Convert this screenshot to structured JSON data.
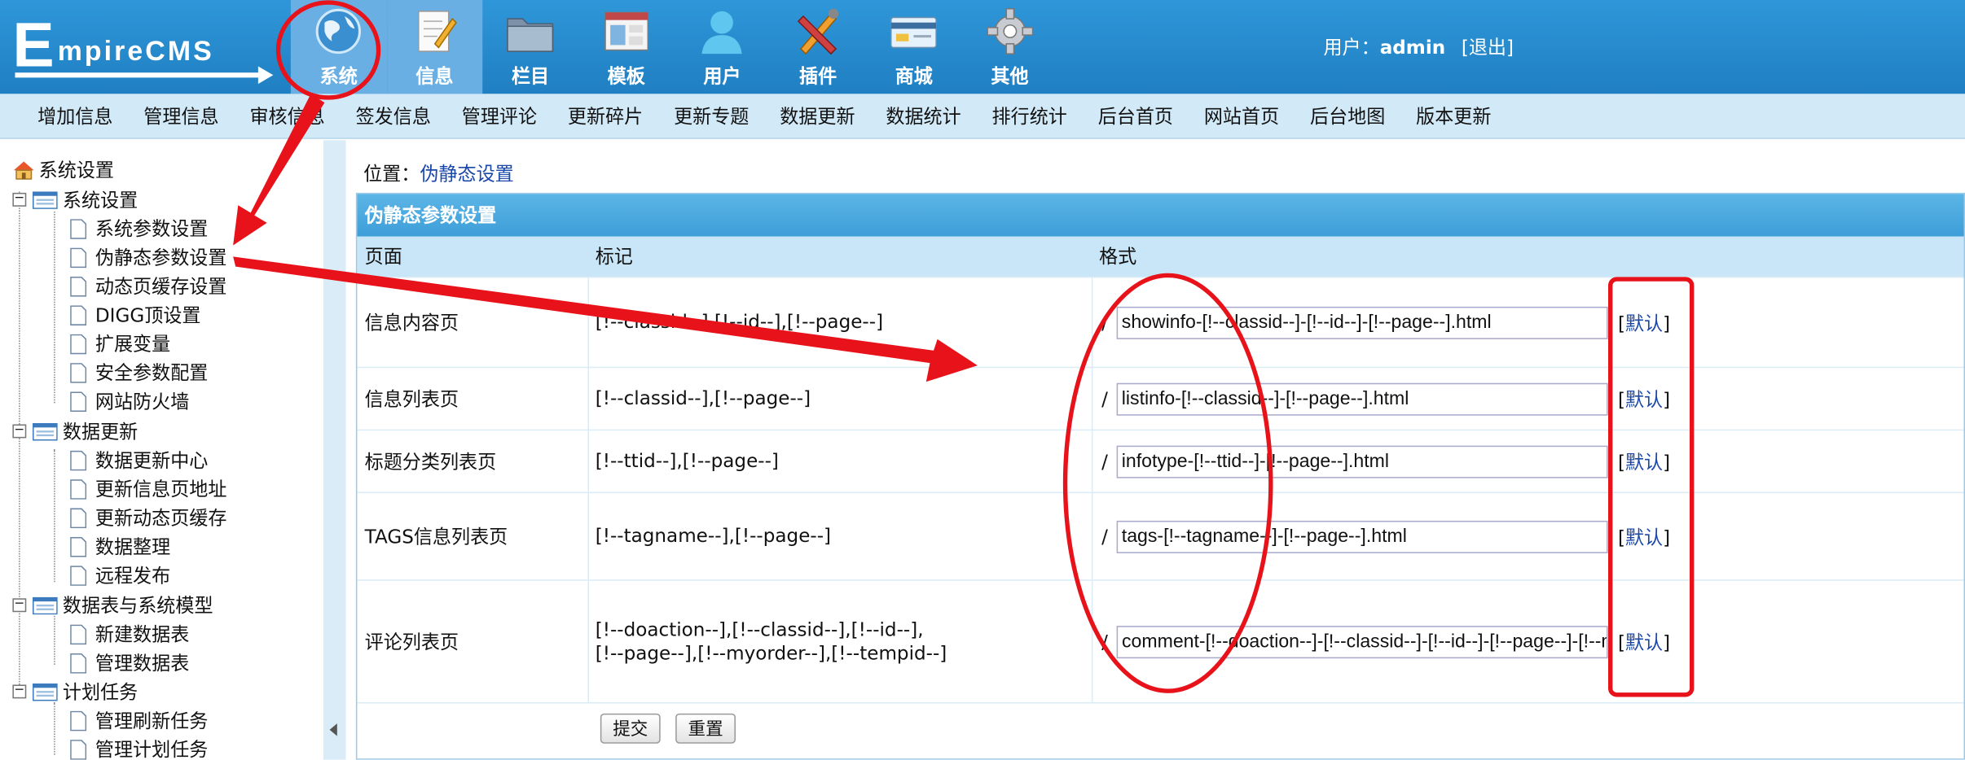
{
  "logo": {
    "first": "E",
    "rest": "mpireCMS"
  },
  "nav": [
    {
      "label": "系统",
      "icon": "globe-icon"
    },
    {
      "label": "信息",
      "icon": "document-pencil-icon"
    },
    {
      "label": "栏目",
      "icon": "folder-icon"
    },
    {
      "label": "模板",
      "icon": "window-template-icon"
    },
    {
      "label": "用户",
      "icon": "user-icon"
    },
    {
      "label": "插件",
      "icon": "tools-icon"
    },
    {
      "label": "商城",
      "icon": "credit-card-icon"
    },
    {
      "label": "其他",
      "icon": "gear-icon"
    }
  ],
  "user": {
    "prefix": "用户：",
    "name": "admin",
    "logout": "[退出]"
  },
  "submenu": [
    "增加信息",
    "管理信息",
    "审核信息",
    "签发信息",
    "管理评论",
    "更新碎片",
    "更新专题",
    "数据更新",
    "数据统计",
    "排行统计",
    "后台首页",
    "网站首页",
    "后台地图",
    "版本更新"
  ],
  "sidebar": {
    "root": "系统设置",
    "groups": [
      {
        "label": "系统设置",
        "items": [
          "系统参数设置",
          "伪静态参数设置",
          "动态页缓存设置",
          "DIGG顶设置",
          "扩展变量",
          "安全参数配置",
          "网站防火墙"
        ]
      },
      {
        "label": "数据更新",
        "items": [
          "数据更新中心",
          "更新信息页地址",
          "更新动态页缓存",
          "数据整理",
          "远程发布"
        ]
      },
      {
        "label": "数据表与系统模型",
        "items": [
          "新建数据表",
          "管理数据表"
        ]
      },
      {
        "label": "计划任务",
        "items": [
          "管理刷新任务",
          "管理计划任务"
        ]
      }
    ]
  },
  "breadcrumb": {
    "prefix": "位置：",
    "link": "伪静态设置"
  },
  "panel": {
    "title": "伪静态参数设置",
    "headers": {
      "page": "页面",
      "mark": "标记",
      "format": "格式"
    },
    "separator": "/",
    "default_label": "默认",
    "rows": [
      {
        "page": "信息内容页",
        "mark": "[!--classid--],[!--id--],[!--page--]",
        "format": "showinfo-[!--classid--]-[!--id--]-[!--page--].html"
      },
      {
        "page": "信息列表页",
        "mark": "[!--classid--],[!--page--]",
        "format": "listinfo-[!--classid--]-[!--page--].html"
      },
      {
        "page": "标题分类列表页",
        "mark": "[!--ttid--],[!--page--]",
        "format": "infotype-[!--ttid--]-[!--page--].html"
      },
      {
        "page": "TAGS信息列表页",
        "mark": "[!--tagname--],[!--page--]",
        "format": "tags-[!--tagname--]-[!--page--].html"
      },
      {
        "page": "评论列表页",
        "mark": "[!--doaction--],[!--classid--],[!--id--],\n[!--page--],[!--myorder--],[!--tempid--]",
        "format": "comment-[!--doaction--]-[!--classid--]-[!--id--]-[!--page--]-[!--myorder--]-[!--tempid--].html"
      }
    ],
    "submit_label": "提交",
    "reset_label": "重置"
  },
  "colors": {
    "header": "#2f97d9",
    "submenu": "#d2e9f8",
    "panel_title": "#4aa9de",
    "annotation": "#e8131a",
    "link": "#1a47a8"
  }
}
